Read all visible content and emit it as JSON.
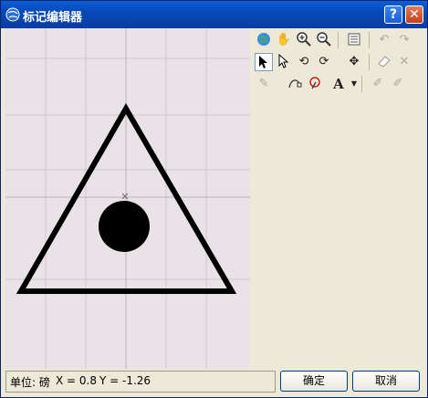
{
  "window": {
    "title": "标记编辑器",
    "help_label": "?",
    "close_label": "✕"
  },
  "toolbar": {
    "rows": [
      [
        "globe-icon",
        "pan-hand-icon",
        "zoom-in-icon",
        "zoom-out-icon",
        "properties-list-icon",
        "undo-icon",
        "redo-icon"
      ],
      [
        "select-arrow-icon",
        "select-arrow-alt-icon",
        "rotate-icon",
        "rotate-alt-icon",
        "move-icon",
        "eraser-icon",
        "delete-icon"
      ],
      [
        "point-tool-icon",
        "curve-tool-icon",
        "freehand-tool-icon",
        "text-tool-icon",
        "edit-vertex-icon",
        "edit-vertex-alt-icon"
      ]
    ]
  },
  "status": {
    "unit_label": "单位: 磅",
    "x_label": "X = 0.8",
    "y_label": "Y = -1.26"
  },
  "buttons": {
    "ok_label": "确定",
    "cancel_label": "取消"
  }
}
